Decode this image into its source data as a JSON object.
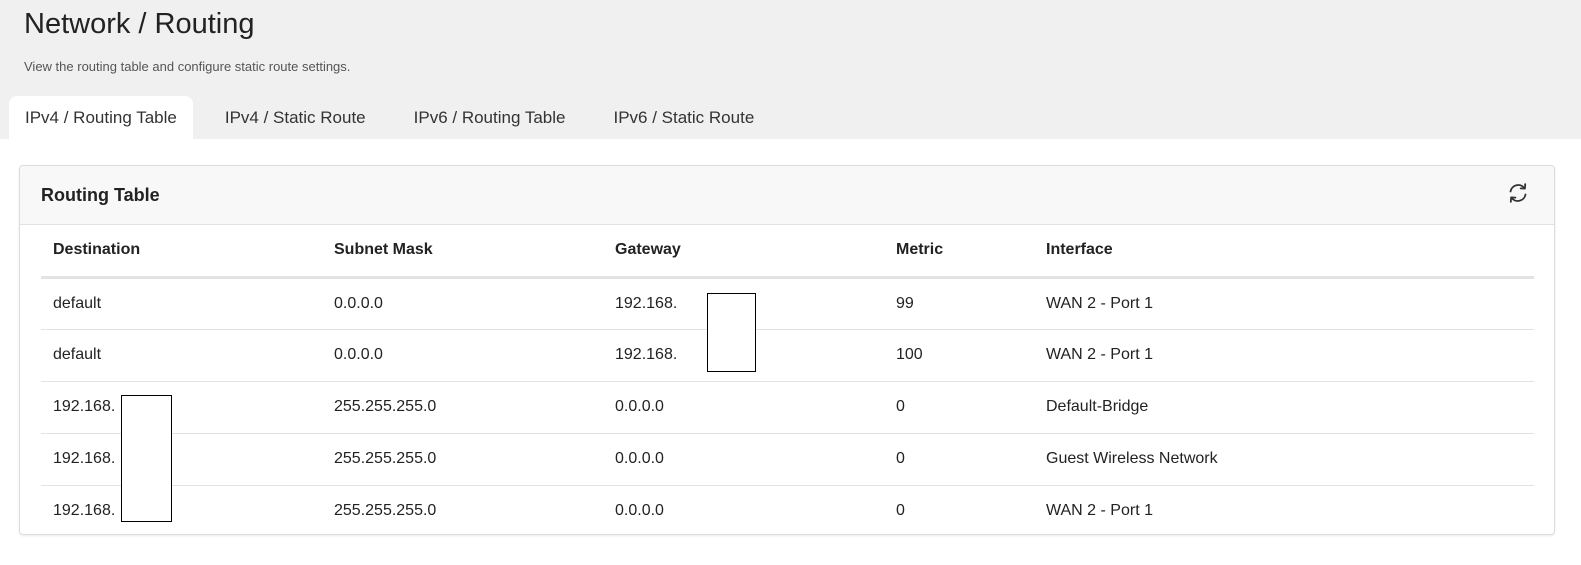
{
  "page": {
    "title": "Network / Routing",
    "subtitle": "View the routing table and configure static route settings."
  },
  "tabs": [
    {
      "label": "IPv4 / Routing Table",
      "active": true
    },
    {
      "label": "IPv4 / Static Route",
      "active": false
    },
    {
      "label": "IPv6 / Routing Table",
      "active": false
    },
    {
      "label": "IPv6 / Static Route",
      "active": false
    }
  ],
  "card": {
    "title": "Routing Table",
    "refresh_icon": "refresh-icon"
  },
  "table": {
    "headers": {
      "destination": "Destination",
      "subnet_mask": "Subnet Mask",
      "gateway": "Gateway",
      "metric": "Metric",
      "interface": "Interface"
    },
    "rows": [
      {
        "destination": "default",
        "subnet_mask": "0.0.0.0",
        "gateway": "192.168.",
        "metric": "99",
        "interface": "WAN 2 - Port 1"
      },
      {
        "destination": "default",
        "subnet_mask": "0.0.0.0",
        "gateway": "192.168.",
        "metric": "100",
        "interface": "WAN 2 - Port 1"
      },
      {
        "destination": "192.168.",
        "subnet_mask": "255.255.255.0",
        "gateway": "0.0.0.0",
        "metric": "0",
        "interface": "Default-Bridge"
      },
      {
        "destination": "192.168.",
        "subnet_mask": "255.255.255.0",
        "gateway": "0.0.0.0",
        "metric": "0",
        "interface": "Guest Wireless Network"
      },
      {
        "destination": "192.168.",
        "subnet_mask": "255.255.255.0",
        "gateway": "0.0.0.0",
        "metric": "0",
        "interface": "WAN 2 - Port 1"
      }
    ]
  }
}
